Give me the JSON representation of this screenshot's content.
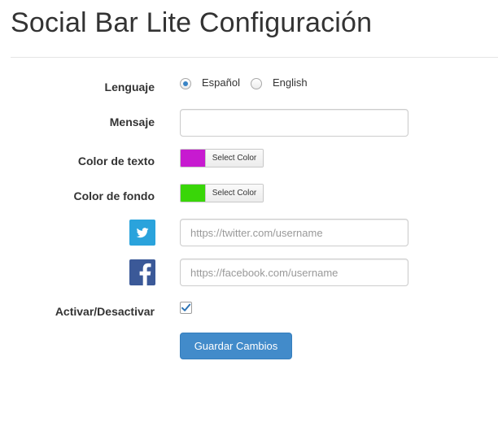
{
  "page": {
    "title": "Social Bar Lite Configuración"
  },
  "form": {
    "language": {
      "label": "Lenguaje",
      "options": [
        "Español",
        "English"
      ],
      "selected": "Español"
    },
    "message": {
      "label": "Mensaje",
      "value": "",
      "placeholder": ""
    },
    "text_color": {
      "label": "Color de texto",
      "color": "#c71ad0",
      "button_label": "Select Color"
    },
    "background_color": {
      "label": "Color de fondo",
      "color": "#39d608",
      "button_label": "Select Color"
    },
    "twitter": {
      "icon": "twitter-icon",
      "brand_color": "#2aa3dc",
      "value": "",
      "placeholder": "https://twitter.com/username"
    },
    "facebook": {
      "icon": "facebook-icon",
      "brand_color": "#3b5998",
      "value": "",
      "placeholder": "https://facebook.com/username"
    },
    "toggle": {
      "label": "Activar/Desactivar",
      "checked": true
    },
    "submit_label": "Guardar Cambios"
  },
  "colors": {
    "primary": "#428bca"
  }
}
